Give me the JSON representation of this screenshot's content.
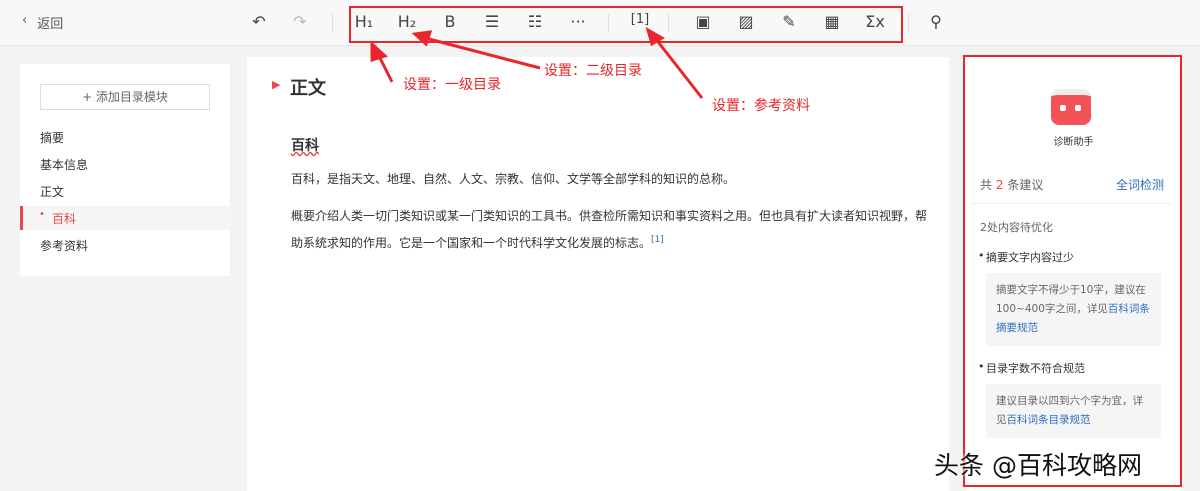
{
  "topbar": {
    "back": "返回",
    "tools": [
      "H₁",
      "H₂",
      "B",
      "☰",
      "☷",
      "···",
      "[1]",
      "▣",
      "▨",
      "✎",
      "▦",
      "Σx"
    ]
  },
  "annotations": {
    "h1": "设置：一级目录",
    "h2": "设置：二级目录",
    "ref": "设置：参考资料"
  },
  "toc": {
    "add": "+ 添加目录模块",
    "items": [
      "摘要",
      "基本信息",
      "正文",
      "百科",
      "参考资料"
    ]
  },
  "editor": {
    "section": "正文",
    "subsection": "百科",
    "p1": "百科，是指天文、地理、自然、人文、宗教、信仰、文学等全部学科的知识的总称。",
    "p2": "概要介绍人类一切门类知识或某一门类知识的工具书。供查检所需知识和事实资料之用。但也具有扩大读者知识视野，帮助系统求知的作用。它是一个国家和一个时代科学文化发展的标志。",
    "ref": "[1]"
  },
  "side": {
    "title": "诊断助手",
    "count_pre": "共",
    "count": "2",
    "count_post": "条建议",
    "check": "全词检测",
    "summary": "2处内容待优化",
    "issues": [
      {
        "title": "摘要文字内容过少",
        "text": "摘要文字不得少于10字，建议在100~400字之间，详见",
        "link": "百科词条摘要规范"
      },
      {
        "title": "目录字数不符合规范",
        "text": "建议目录以四到六个字为宜，详见",
        "link": "百科词条目录规范"
      }
    ]
  },
  "watermark": "头条 @百科攻略网"
}
